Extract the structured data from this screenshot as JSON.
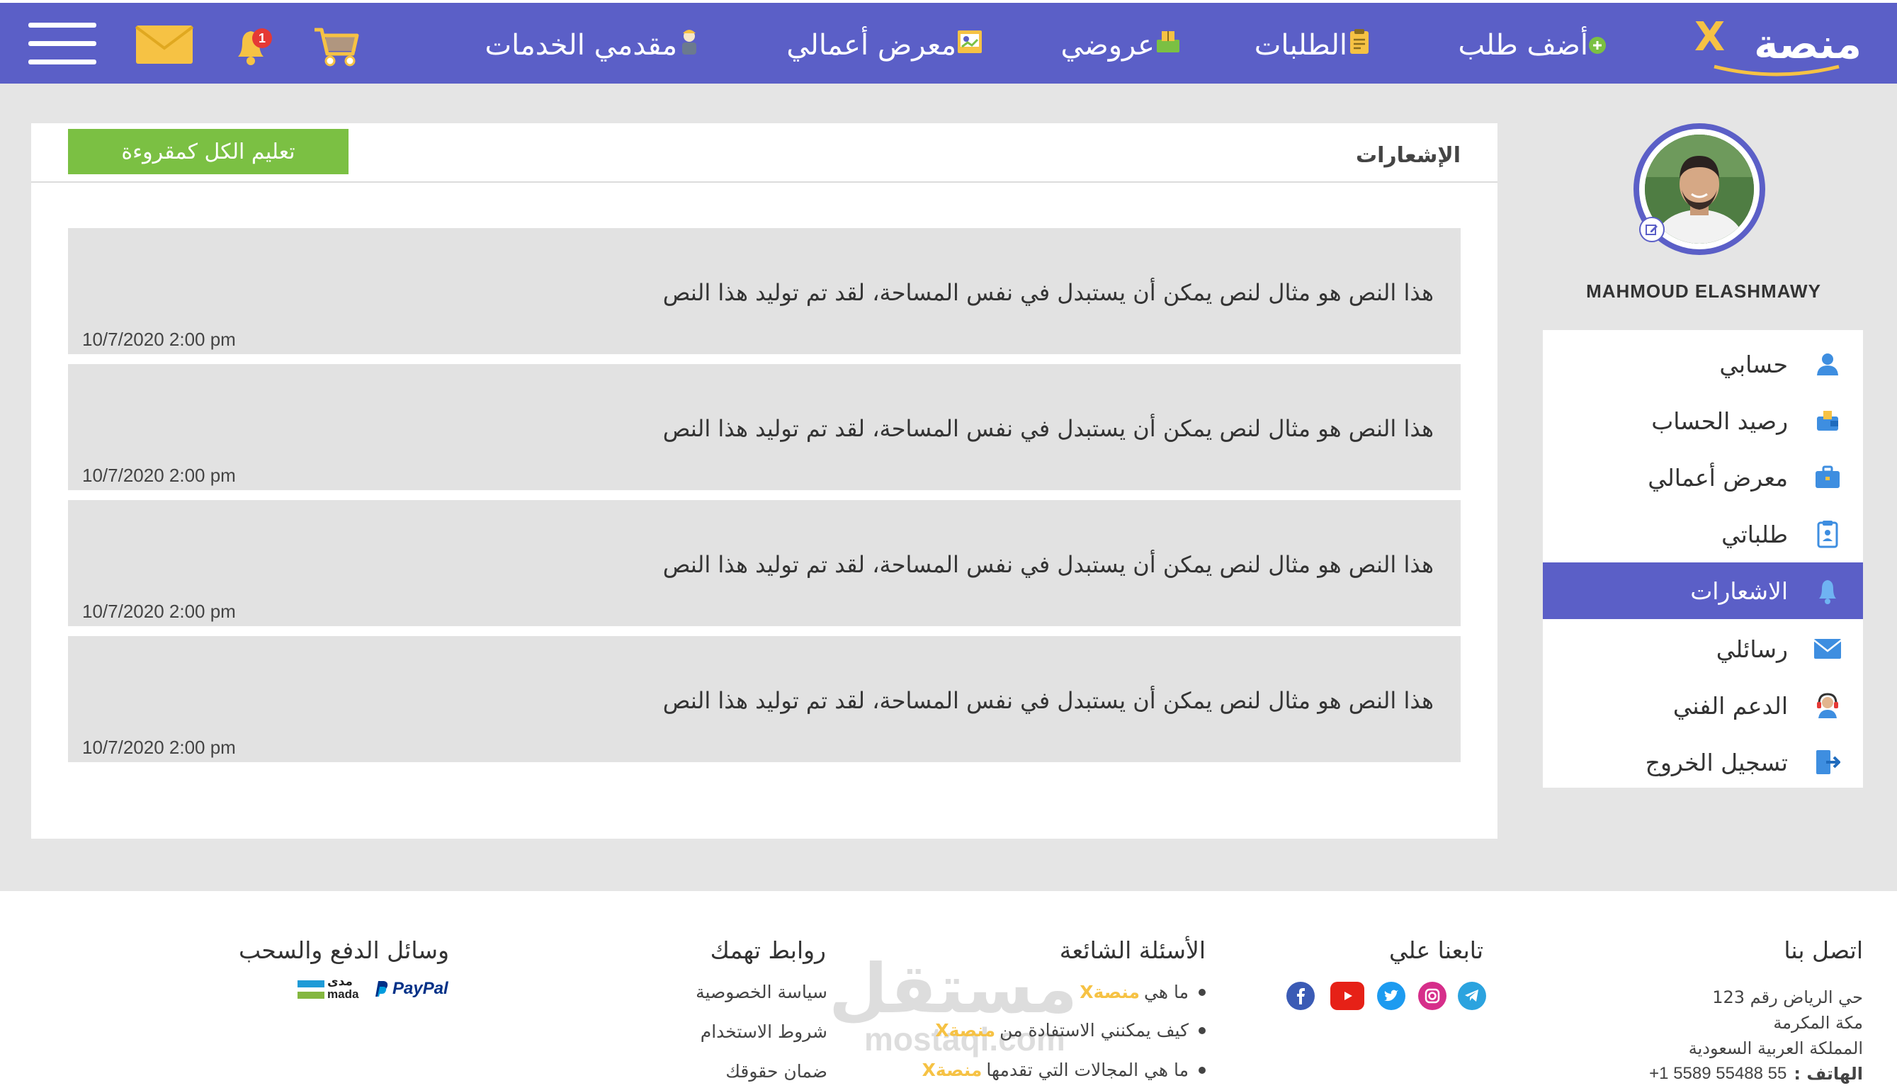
{
  "brand": {
    "name": "منصة",
    "x_letter": "X"
  },
  "colors": {
    "primary": "#5b5fc7",
    "accent": "#f6c244",
    "green": "#7bc043",
    "panel_grey": "#e2e2e2"
  },
  "nav": {
    "add_request": "أضف طلب",
    "requests": "الطلبات",
    "offers": "عروضي",
    "portfolio": "معرض أعمالي",
    "providers": "مقدمي الخدمات",
    "notification_count": "1"
  },
  "notifications_panel": {
    "title": "الإشعارات",
    "mark_all_read": "تعليم الكل كمقروءة",
    "items": [
      {
        "text": "هذا النص هو مثال لنص يمكن أن يستبدل في نفس المساحة، لقد تم توليد هذا النص",
        "time": "10/7/2020 2:00 pm"
      },
      {
        "text": "هذا النص هو مثال لنص يمكن أن يستبدل في نفس المساحة، لقد تم توليد هذا النص",
        "time": "10/7/2020 2:00 pm"
      },
      {
        "text": "هذا النص هو مثال لنص يمكن أن يستبدل في نفس المساحة، لقد تم توليد هذا النص",
        "time": "10/7/2020 2:00 pm"
      },
      {
        "text": "هذا النص هو مثال لنص يمكن أن يستبدل في نفس المساحة، لقد تم توليد هذا النص",
        "time": "10/7/2020 2:00 pm"
      }
    ]
  },
  "profile": {
    "name": "MAHMOUD ELASHMAWY"
  },
  "sidebar": {
    "items": [
      {
        "label": "حسابي",
        "icon": "user-icon"
      },
      {
        "label": "رصيد الحساب",
        "icon": "wallet-icon"
      },
      {
        "label": "معرض أعمالي",
        "icon": "briefcase-icon"
      },
      {
        "label": "طلباتي",
        "icon": "clipboard-icon"
      },
      {
        "label": "الاشعارات",
        "icon": "bell-icon",
        "active": true
      },
      {
        "label": "رسائلي",
        "icon": "envelope-icon"
      },
      {
        "label": "الدعم الفني",
        "icon": "headset-icon"
      },
      {
        "label": "تسجيل الخروج",
        "icon": "logout-icon"
      }
    ]
  },
  "footer": {
    "contact": {
      "title": "اتصل بنا",
      "line1": "حي الرياض رقم 123",
      "line2": "مكة المكرمة",
      "line3": "المملكة العربية السعودية",
      "phone_label": "الهاتف :",
      "phone_value": "+1 5589 55488 55"
    },
    "follow": {
      "title": "تابعنا علي"
    },
    "faq": {
      "title": "الأسئلة الشائعة",
      "items": [
        {
          "text": "ما هي",
          "brand": "منصةX"
        },
        {
          "text": "كيف يمكنني الاستفادة من",
          "brand": "منصةX"
        },
        {
          "text": "ما هي المجالات التي تقدمها",
          "brand": "منصةX"
        }
      ]
    },
    "links": {
      "title": "روابط تهمك",
      "items": [
        "سياسة الخصوصية",
        "شروط الاستخدام",
        "ضمان حقوقك"
      ]
    },
    "payments": {
      "title": "وسائل الدفع والسحب",
      "paypal": "PayPal",
      "mada_ar": "مدى",
      "mada_en": "mada"
    },
    "watermark": {
      "ar": "مستقل",
      "en": "mostaql.com"
    }
  }
}
